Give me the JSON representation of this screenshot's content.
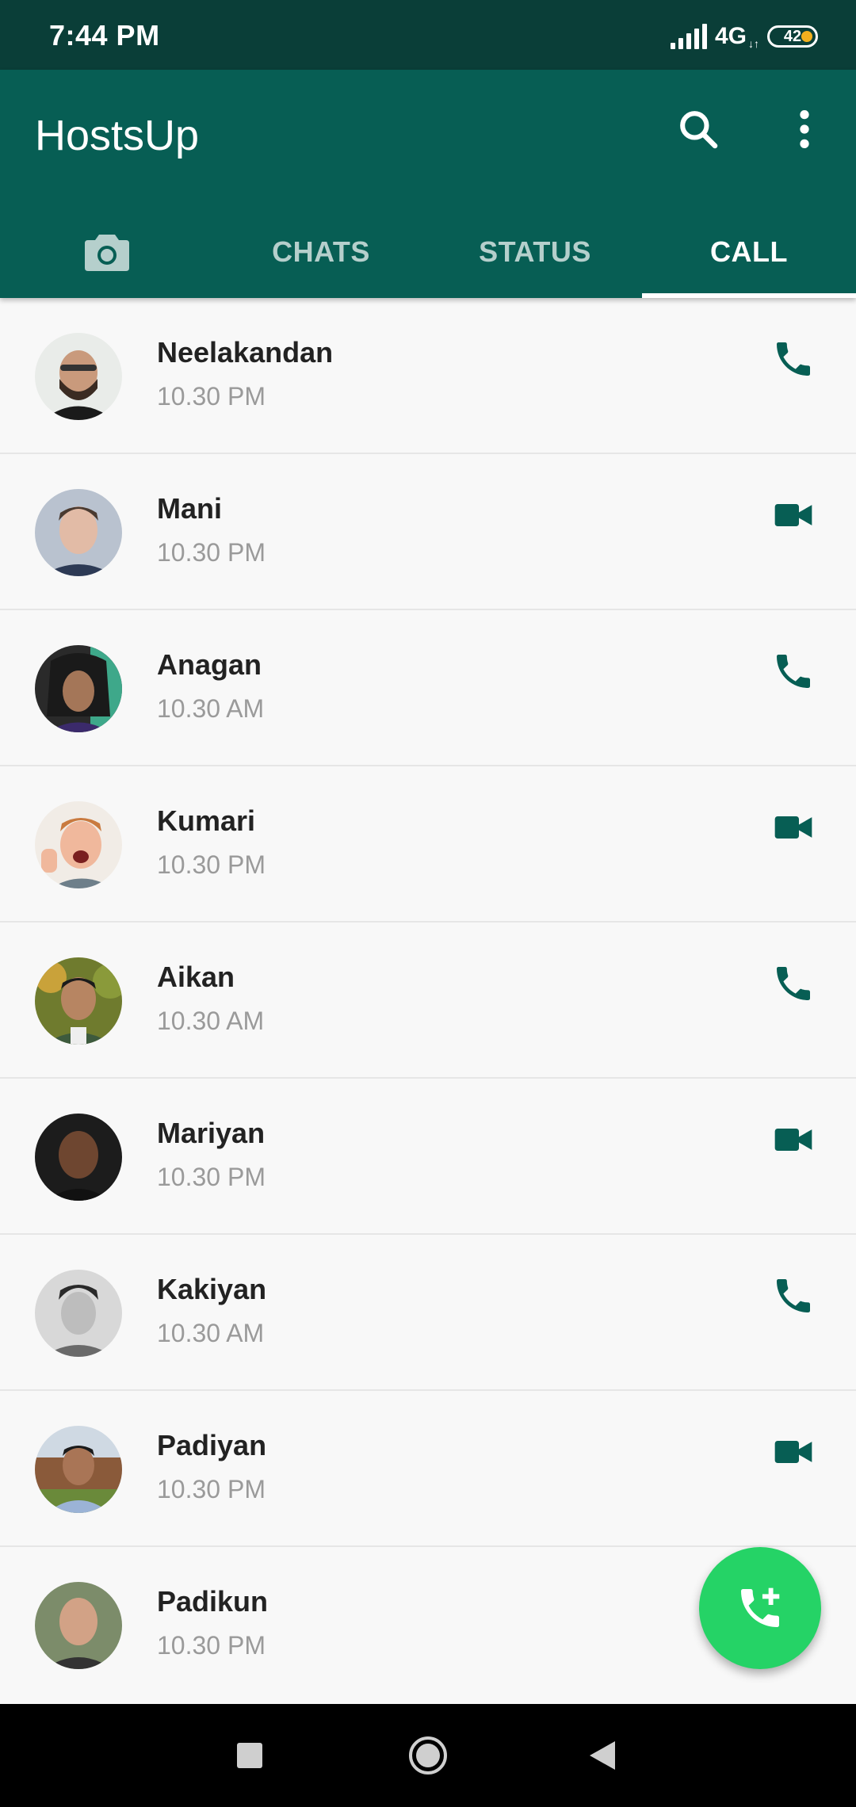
{
  "status_bar": {
    "time": "7:44 PM",
    "network": "4G",
    "battery": "42"
  },
  "app": {
    "title": "HostsUp"
  },
  "tabs": [
    {
      "label": "",
      "icon": "camera-icon"
    },
    {
      "label": "CHATS"
    },
    {
      "label": "STATUS"
    },
    {
      "label": "CALL",
      "active": true
    }
  ],
  "calls": [
    {
      "name": "Neelakandan",
      "time": "10.30 PM",
      "type": "voice"
    },
    {
      "name": "Mani",
      "time": "10.30 PM",
      "type": "video"
    },
    {
      "name": "Anagan",
      "time": "10.30 AM",
      "type": "voice"
    },
    {
      "name": "Kumari",
      "time": "10.30 PM",
      "type": "video"
    },
    {
      "name": "Aikan",
      "time": "10.30 AM",
      "type": "voice"
    },
    {
      "name": "Mariyan",
      "time": "10.30 PM",
      "type": "video"
    },
    {
      "name": "Kakiyan",
      "time": "10.30 AM",
      "type": "voice"
    },
    {
      "name": "Padiyan",
      "time": "10.30 PM",
      "type": "video"
    },
    {
      "name": "Padikun",
      "time": "10.30 PM",
      "type": "voice"
    }
  ],
  "colors": {
    "primary": "#075e54",
    "status_bar": "#0a3e38",
    "fab": "#25d366",
    "name_text": "#222222",
    "time_text": "#9a9a9a"
  }
}
